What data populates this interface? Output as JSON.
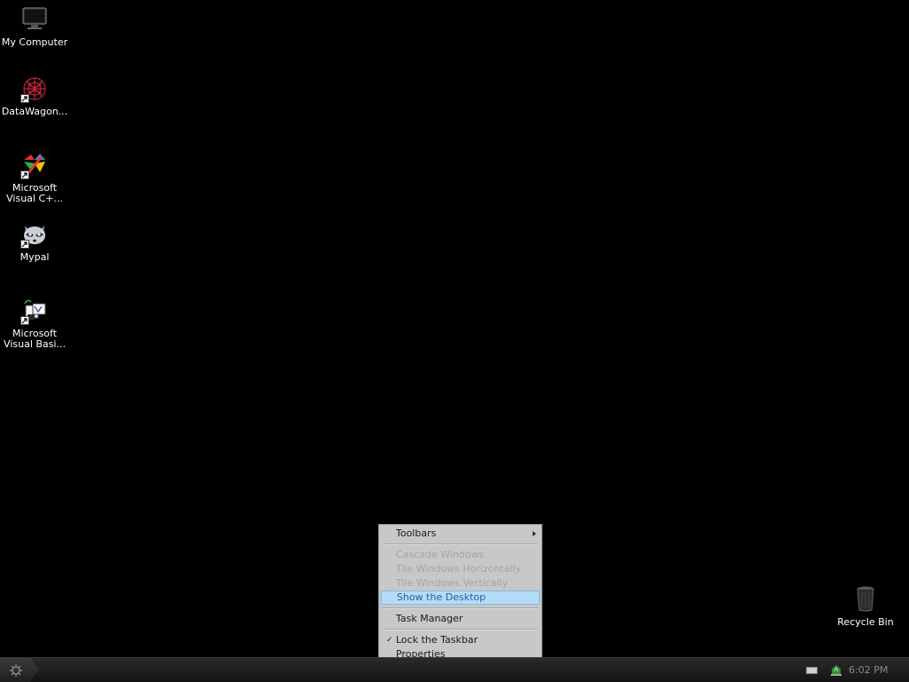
{
  "desktop": {
    "icons": [
      {
        "label": "My Computer",
        "icon": "monitor-icon"
      },
      {
        "label": "DataWagon...",
        "icon": "red-flower-icon"
      },
      {
        "label": "Microsoft\nVisual C+...",
        "icon": "visual-cpp-icon"
      },
      {
        "label": "Mypal",
        "icon": "raccoon-icon"
      },
      {
        "label": "Microsoft\nVisual Basi...",
        "icon": "visual-basic-icon"
      }
    ],
    "recycle_bin": {
      "label": "Recycle Bin",
      "icon": "trash-can-icon"
    }
  },
  "context_menu": {
    "items": [
      {
        "label": "Toolbars",
        "enabled": true,
        "submenu": true
      },
      {
        "label": "Cascade Windows",
        "enabled": false
      },
      {
        "label": "Tile Windows Horizontally",
        "enabled": false
      },
      {
        "label": "Tile Windows Vertically",
        "enabled": false
      },
      {
        "label": "Show the Desktop",
        "enabled": true,
        "highlighted": true
      },
      {
        "label": "Task Manager",
        "enabled": true
      },
      {
        "label": "Lock the Taskbar",
        "enabled": true,
        "checked": true
      },
      {
        "label": "Properties",
        "enabled": true
      }
    ],
    "check_glyph": "✓"
  },
  "taskbar": {
    "clock": "6:02 PM",
    "tray_icons": [
      "keyboard-icon",
      "network-icon"
    ]
  },
  "colors": {
    "desktop_bg": "#000000",
    "menu_bg": "#c8c8c8",
    "menu_highlight": "#b4dcf8",
    "menu_highlight_text": "#2a5d9e",
    "taskbar_bg": "#1a1a1a"
  }
}
